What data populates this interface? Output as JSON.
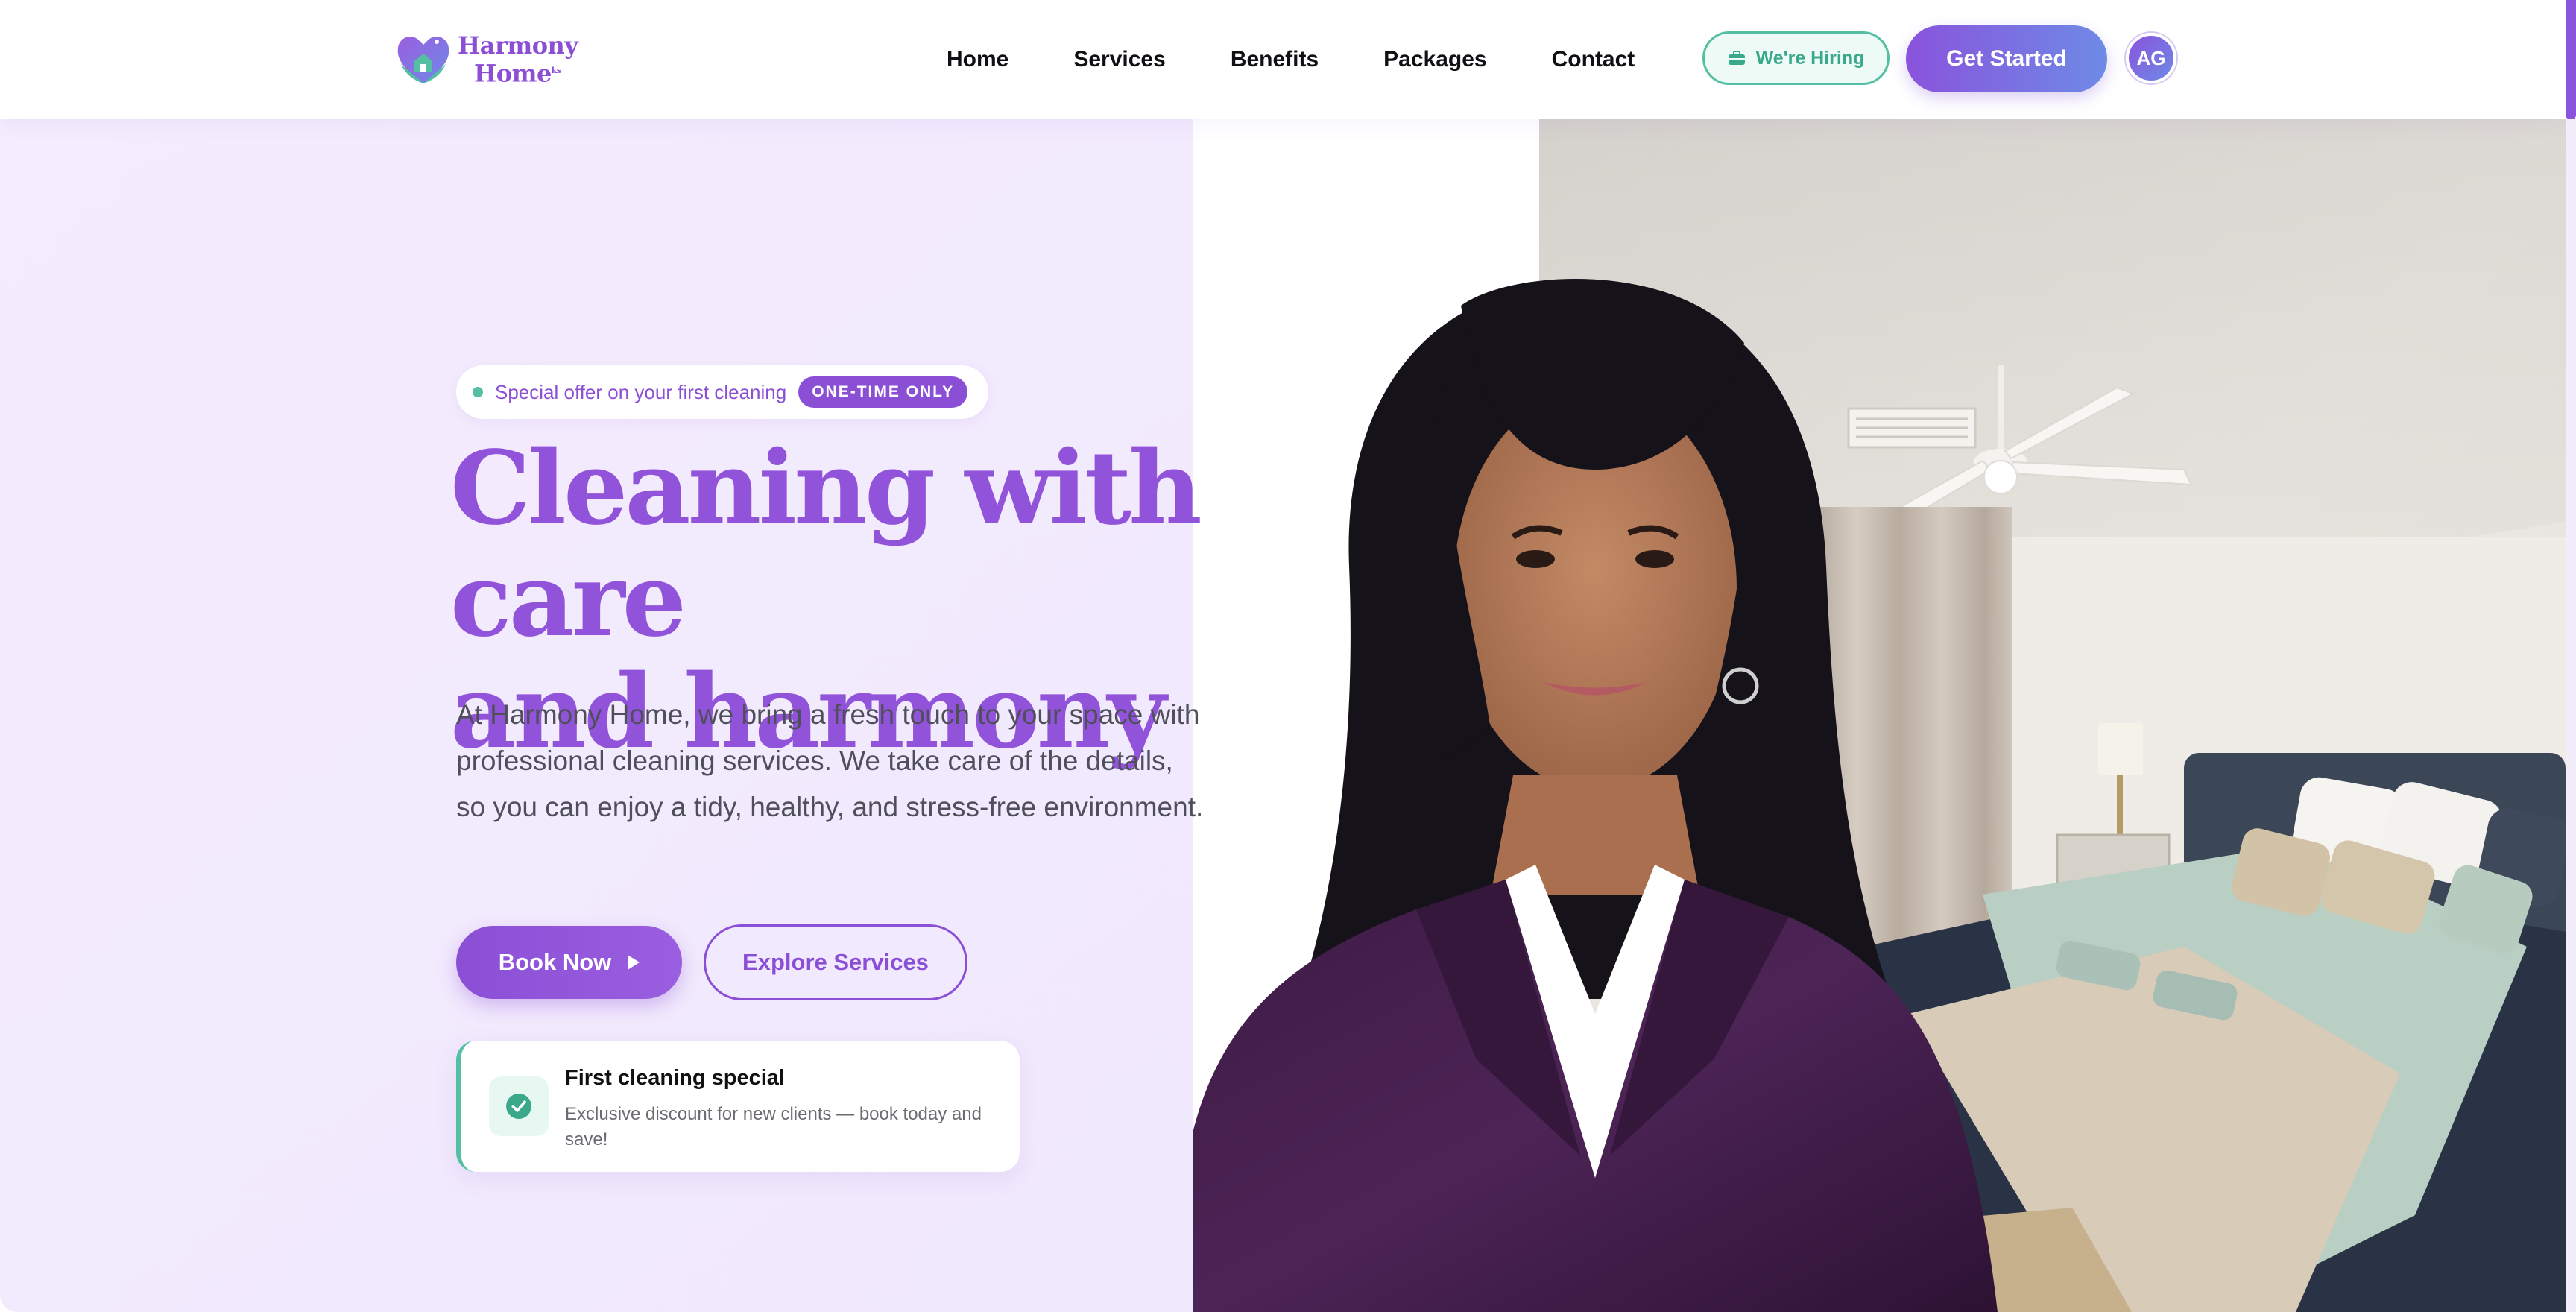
{
  "brand": {
    "name_line1": "Harmony",
    "name_line2": "Home",
    "name_suffix": "ks",
    "primary_color": "#8b4fd6",
    "accent_color": "#54bfa3"
  },
  "nav": {
    "links": [
      "Home",
      "Services",
      "Benefits",
      "Packages",
      "Contact"
    ],
    "hiring_label": "We're Hiring",
    "hiring_icon": "briefcase-icon",
    "cta_label": "Get Started",
    "avatar_initials": "AG"
  },
  "hero": {
    "offer_text": "Special offer on your first cleaning",
    "offer_badge": "ONE-TIME ONLY",
    "headline_line1": "Cleaning with care",
    "headline_line2": "and harmony",
    "description": "At Harmony Home, we bring a fresh touch to your space with professional cleaning services. We take care of the details, so you can enjoy a tidy, healthy, and stress-free environment.",
    "book_label": "Book Now",
    "book_icon": "play-arrow-icon",
    "explore_label": "Explore Services",
    "special_title": "First cleaning special",
    "special_text": "Exclusive discount for new clients — book today and save!",
    "special_icon": "check-circle-icon"
  }
}
